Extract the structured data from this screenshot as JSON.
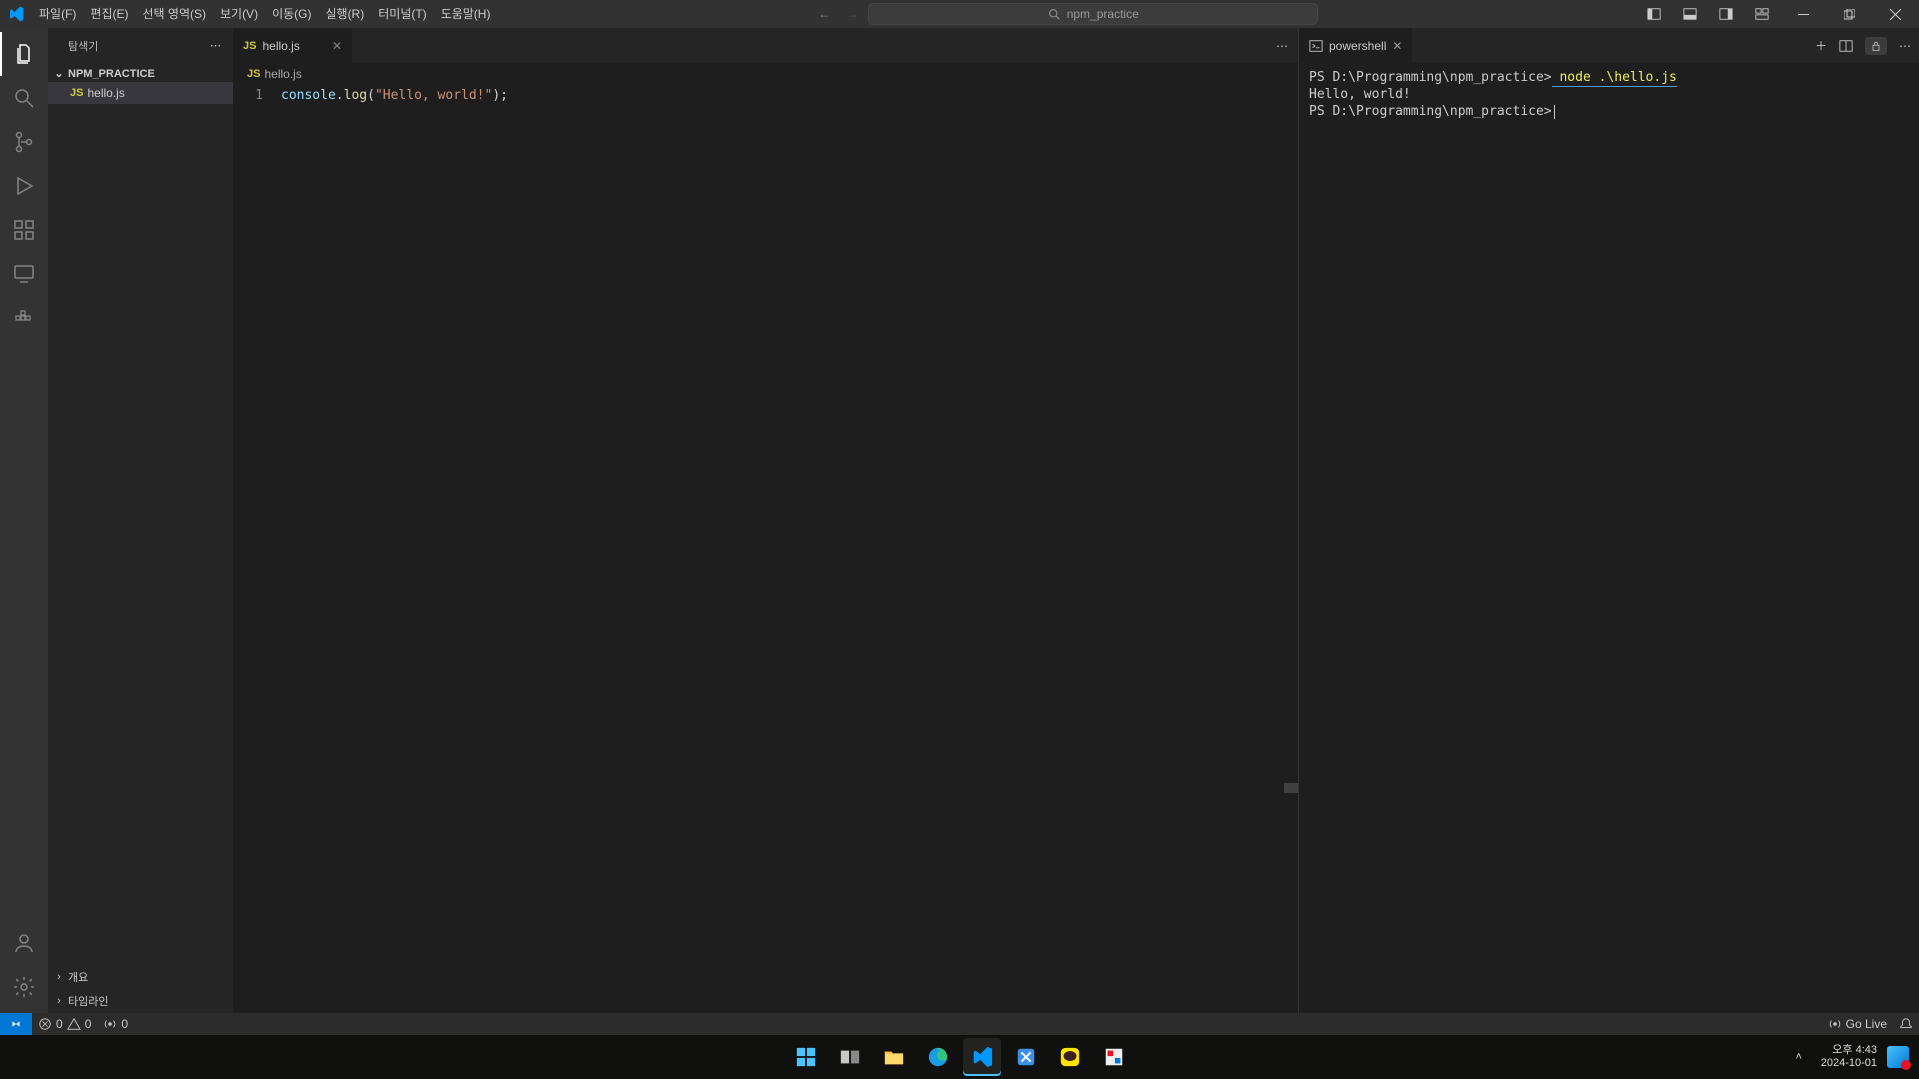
{
  "menubar": [
    "파일(F)",
    "편집(E)",
    "선택 영역(S)",
    "보기(V)",
    "이동(G)",
    "실행(R)",
    "터미널(T)",
    "도움말(H)"
  ],
  "commandCenter": {
    "placeholder": "npm_practice"
  },
  "explorer": {
    "title": "탐색기",
    "project": "NPM_PRACTICE",
    "files": [
      {
        "name": "hello.js",
        "icon": "JS"
      }
    ],
    "outline": "개요",
    "timeline": "타임라인"
  },
  "editor": {
    "tab": {
      "name": "hello.js",
      "icon": "JS"
    },
    "breadcrumb": {
      "name": "hello.js",
      "icon": "JS"
    },
    "lineNumber": "1",
    "code": {
      "obj": "console",
      "dot": ".",
      "fn": "log",
      "open": "(",
      "str": "\"Hello, world!\"",
      "close": ");"
    }
  },
  "terminal": {
    "tabName": "powershell",
    "prompt1": "PS D:\\Programming\\npm_practice>",
    "cmd1": " node .\\hello.js ",
    "output": "Hello, world!",
    "prompt2": "PS D:\\Programming\\npm_practice>"
  },
  "statusbar": {
    "errors": "0",
    "warnings": "0",
    "ports": "0",
    "golive": "Go Live"
  },
  "taskbar": {
    "time": "오후 4:43",
    "date": "2024-10-01"
  }
}
